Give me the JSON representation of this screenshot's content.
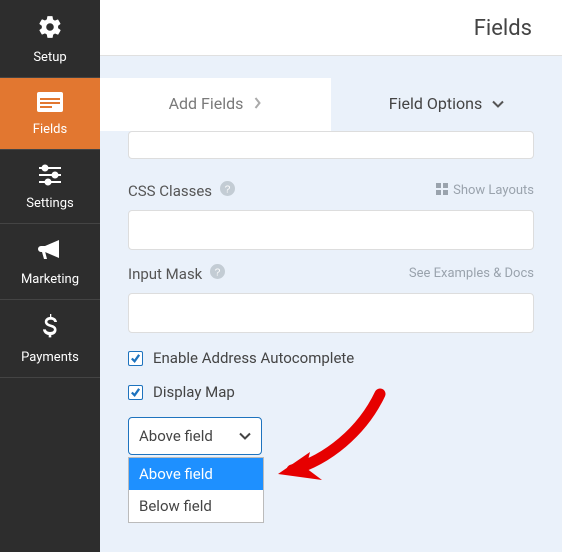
{
  "header": {
    "title": "Fields"
  },
  "sidebar": {
    "items": [
      {
        "label": "Setup"
      },
      {
        "label": "Fields"
      },
      {
        "label": "Settings"
      },
      {
        "label": "Marketing"
      },
      {
        "label": "Payments"
      }
    ]
  },
  "tabs": {
    "add": "Add Fields",
    "options": "Field Options"
  },
  "fields": {
    "css": {
      "label": "CSS Classes",
      "hint": "Show Layouts"
    },
    "mask": {
      "label": "Input Mask",
      "hint": "See Examples & Docs"
    },
    "autocomplete": "Enable Address Autocomplete",
    "displayMap": "Display Map",
    "position": {
      "selected": "Above field",
      "options": [
        "Above field",
        "Below field"
      ]
    }
  }
}
